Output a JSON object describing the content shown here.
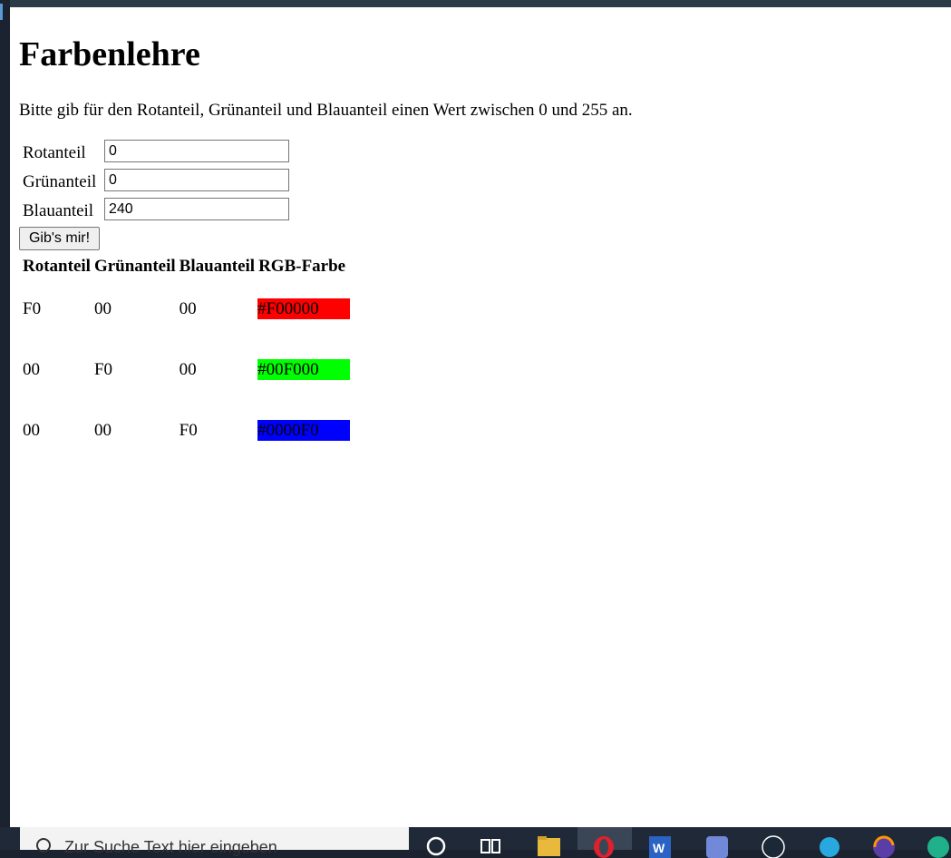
{
  "page": {
    "title": "Farbenlehre",
    "intro": "Bitte gib für den Rotanteil, Grünanteil und Blauanteil einen Wert zwischen 0 und 255 an."
  },
  "form": {
    "red_label": "Rotanteil",
    "red_value": "0",
    "green_label": "Grünanteil",
    "green_value": "0",
    "blue_label": "Blauanteil",
    "blue_value": "240",
    "submit_label": "Gib's mir!"
  },
  "table": {
    "headers": [
      "Rotanteil",
      "Grünanteil",
      "Blauanteil",
      "RGB-Farbe"
    ],
    "rows": [
      {
        "r": "F0",
        "g": "00",
        "b": "00",
        "color": "#F00000",
        "swatch": "#ff0000"
      },
      {
        "r": "00",
        "g": "F0",
        "b": "00",
        "color": "#00F000",
        "swatch": "#00ff00"
      },
      {
        "r": "00",
        "g": "00",
        "b": "F0",
        "color": "#0000F0",
        "swatch": "#0000ff"
      }
    ]
  },
  "taskbar": {
    "search_placeholder": "Zur Suche Text hier eingeben",
    "icons": [
      "search-icon",
      "task-view-icon",
      "file-explorer-icon",
      "opera-icon",
      "word-icon",
      "discord-icon",
      "steam-icon",
      "app-icon",
      "firefox-icon",
      "edge-icon"
    ]
  }
}
